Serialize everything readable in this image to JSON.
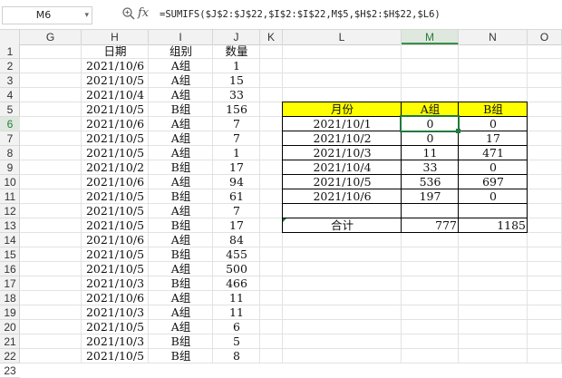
{
  "formula_bar": {
    "name_box": "M6",
    "name_box_dropdown": "▾",
    "zoom_icon": "zoom-icon",
    "fx_label": "fx",
    "formula": "=SUMIFS($J$2:$J$22,$I$2:$I$22,M$5,$H$2:$H$22,$L6)"
  },
  "columns": [
    "G",
    "H",
    "I",
    "J",
    "K",
    "L",
    "M",
    "N",
    "O"
  ],
  "active_column": "M",
  "rows": [
    "1",
    "2",
    "3",
    "4",
    "5",
    "6",
    "7",
    "8",
    "9",
    "10",
    "11",
    "12",
    "13",
    "14",
    "15",
    "16",
    "17",
    "18",
    "19",
    "20",
    "21",
    "22",
    "23"
  ],
  "active_row": "6",
  "data_table": {
    "headers": [
      "日期",
      "组别",
      "数量"
    ],
    "rows": [
      [
        "2021/10/6",
        "A组",
        "1"
      ],
      [
        "2021/10/5",
        "A组",
        "15"
      ],
      [
        "2021/10/4",
        "A组",
        "33"
      ],
      [
        "2021/10/5",
        "B组",
        "156"
      ],
      [
        "2021/10/6",
        "A组",
        "7"
      ],
      [
        "2021/10/5",
        "A组",
        "7"
      ],
      [
        "2021/10/5",
        "A组",
        "1"
      ],
      [
        "2021/10/2",
        "B组",
        "17"
      ],
      [
        "2021/10/6",
        "A组",
        "94"
      ],
      [
        "2021/10/5",
        "B组",
        "61"
      ],
      [
        "2021/10/5",
        "A组",
        "7"
      ],
      [
        "2021/10/5",
        "B组",
        "17"
      ],
      [
        "2021/10/6",
        "A组",
        "84"
      ],
      [
        "2021/10/5",
        "B组",
        "455"
      ],
      [
        "2021/10/5",
        "A组",
        "500"
      ],
      [
        "2021/10/3",
        "B组",
        "466"
      ],
      [
        "2021/10/6",
        "A组",
        "11"
      ],
      [
        "2021/10/3",
        "A组",
        "11"
      ],
      [
        "2021/10/5",
        "A组",
        "6"
      ],
      [
        "2021/10/3",
        "B组",
        "5"
      ],
      [
        "2021/10/5",
        "B组",
        "8"
      ]
    ]
  },
  "summary_table": {
    "headers": [
      "月份",
      "A组",
      "B组"
    ],
    "rows": [
      [
        "2021/10/1",
        "0",
        "0"
      ],
      [
        "2021/10/2",
        "0",
        "17"
      ],
      [
        "2021/10/3",
        "11",
        "471"
      ],
      [
        "2021/10/4",
        "33",
        "0"
      ],
      [
        "2021/10/5",
        "536",
        "697"
      ],
      [
        "2021/10/6",
        "197",
        "0"
      ]
    ],
    "total_label": "合计",
    "total_a": "777",
    "total_b": "1185",
    "header_fill_color": "#ffff00",
    "selection_color": "#1f7a3d"
  }
}
